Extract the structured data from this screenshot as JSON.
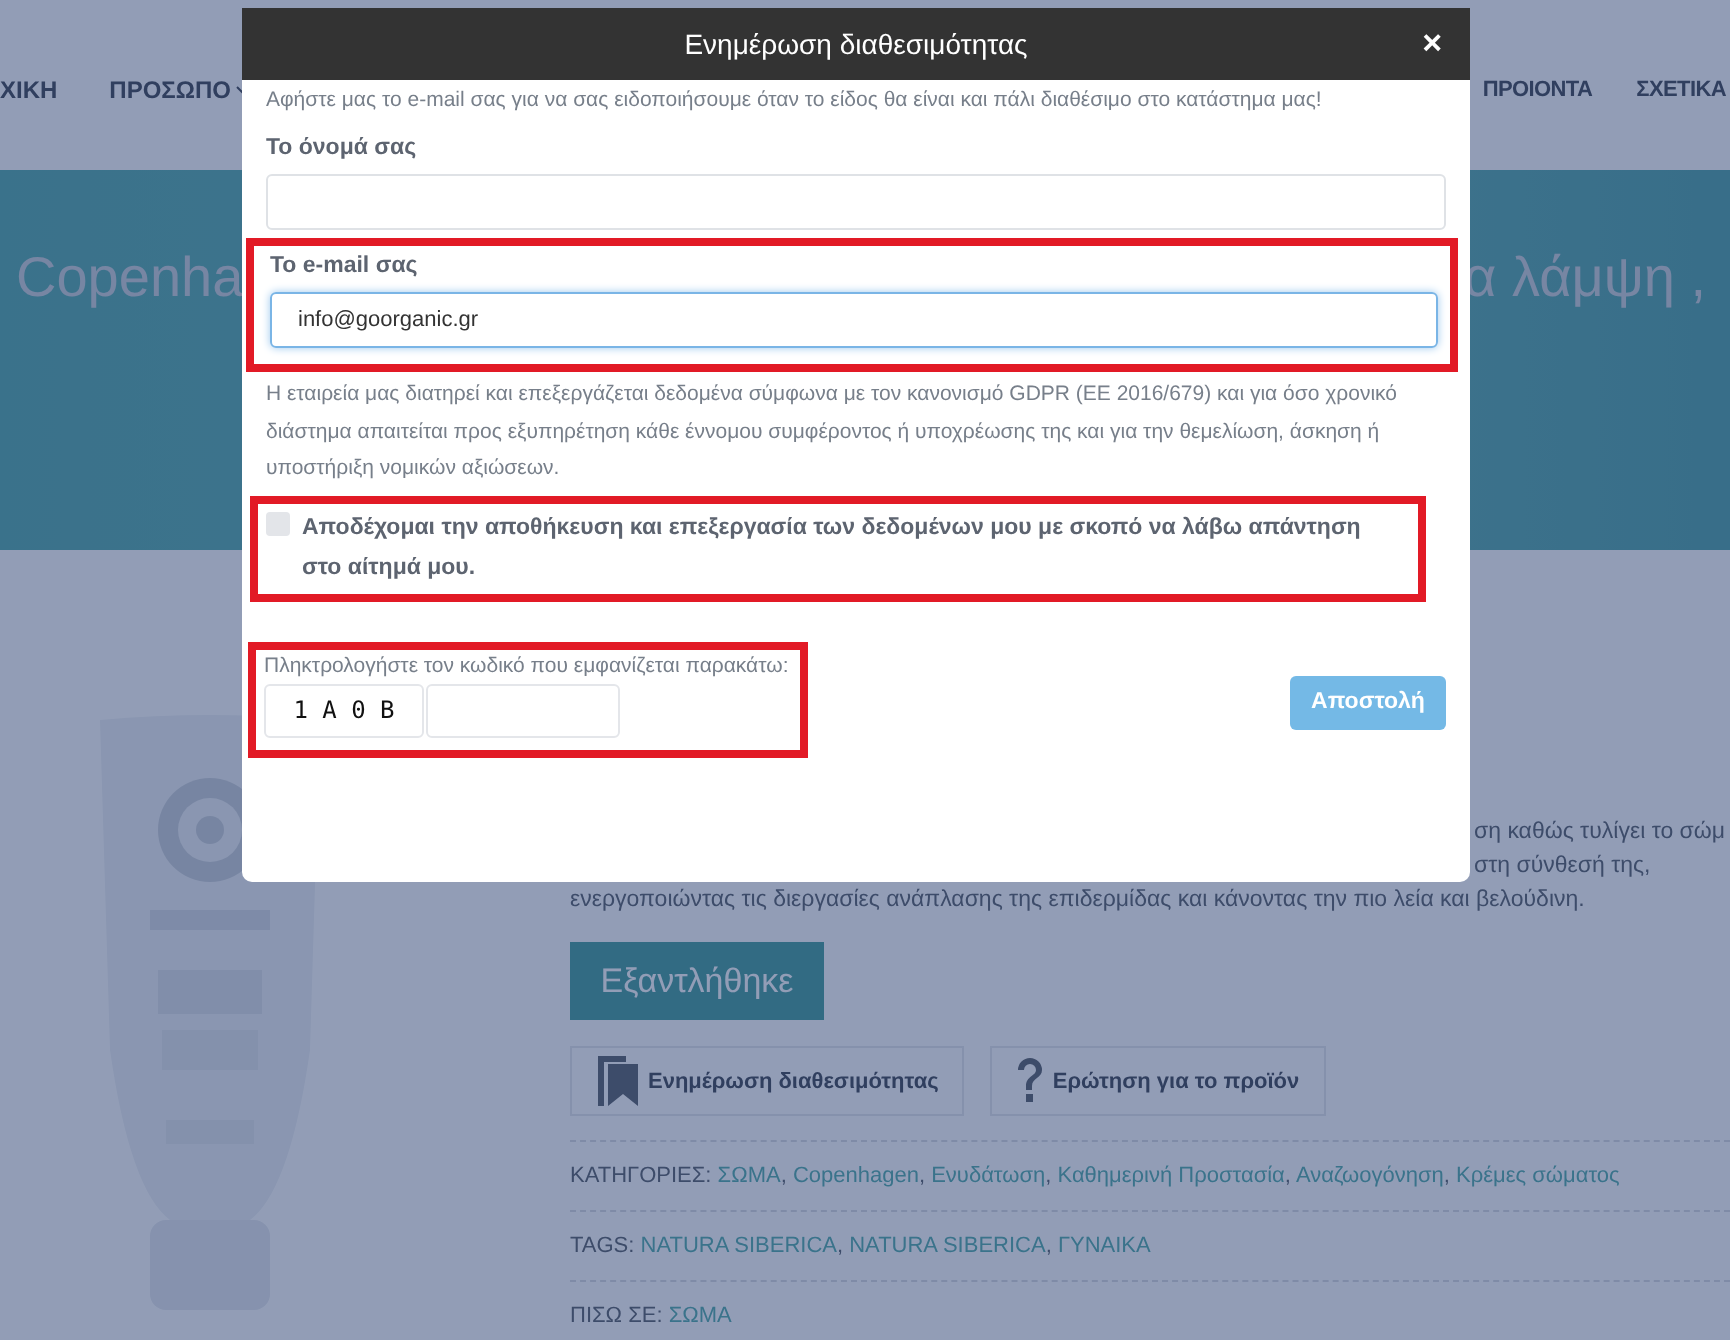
{
  "nav": {
    "left_items": [
      {
        "label": "ΧΙΚΗ",
        "dropdown": false
      },
      {
        "label": "ΠΡΟΣΩΠΟ",
        "dropdown": true
      }
    ],
    "right_items": [
      {
        "label": "ΠΡΟΙΟΝΤΑ",
        "dropdown": false
      },
      {
        "label": "ΣΧΕΤΙΚΑ",
        "dropdown": false
      }
    ]
  },
  "hero": {
    "title_parts": [
      "Copenha",
      "α λάμψη ,"
    ]
  },
  "product": {
    "description_lines": [
      {
        "text": "ση καθώς τυλίγει το σώμ",
        "partly_hidden": true
      },
      {
        "text": "στη σύνθεσή της,",
        "partly_hidden": true
      },
      {
        "text": "ενεργοποιώντας τις διεργασίες ανάπλασης της επιδερμίδας και κάνοντας την πιο λεία και βελούδινη.",
        "partly_hidden": false
      }
    ],
    "status_button": "Εξαντλήθηκε",
    "actions": [
      {
        "kind": "bookmark",
        "label": "Ενημέρωση διαθεσιμότητας"
      },
      {
        "kind": "question",
        "label": "Ερώτηση για το προϊόν"
      }
    ],
    "meta": [
      {
        "label": "ΚΑΤΗΓΟΡΙΕΣ:",
        "separator": ",",
        "links": [
          "ΣΩΜΑ",
          "Copenhagen",
          "Ενυδάτωση",
          "Καθημερινή Προστασία",
          "Αναζωογόνηση",
          "Κρέμες σώματος"
        ]
      },
      {
        "label": "TAGS:",
        "separator": ",",
        "links": [
          "NATURA SIBERICA",
          "NATURA SIBERICA",
          "ΓΥΝΑΙΚΑ"
        ]
      },
      {
        "label": "ΠΙΣΩ ΣΕ:",
        "links": [
          "ΣΩΜΑ"
        ]
      }
    ]
  },
  "modal": {
    "title": "Ενημέρωση διαθεσιμότητας",
    "close": "×",
    "intro": "Αφήστε μας το e-mail σας για να σας ειδοποιήσουμε όταν το είδος θα είναι και πάλι διαθέσιμο στο κατάστημα μας!",
    "name_field": {
      "label": "Το όνομά σας",
      "highlighted": false,
      "focused": false
    },
    "email_field": {
      "label": "Το e-mail σας",
      "value": "info@goorganic.gr",
      "highlighted": true,
      "focused": true
    },
    "privacy_text": "Η εταιρεία μας διατηρεί και επεξεργάζεται δεδομένα σύμφωνα με τον κανονισμό GDPR (ΕΕ 2016/679) και για όσο χρονικό διάστημα απαιτείται προς εξυπηρέτηση κάθε έννομου συμφέροντος ή υποχρέωσης της και για την θεμελίωση, άσκηση ή υποστήριξη νομικών αξιώσεων.",
    "consent": {
      "label": "Αποδέχομαι την αποθήκευση και επεξεργασία των δεδομένων μου με σκοπό να λάβω απάντηση στο αίτημά μου.",
      "checked": false,
      "highlighted": true
    },
    "captcha": {
      "label": "Πληκτρολογήστε τον κωδικό που εμφανίζεται παρακάτω:",
      "code": "1 A 0 B",
      "highlighted": true
    },
    "submit": "Αποστολή"
  }
}
